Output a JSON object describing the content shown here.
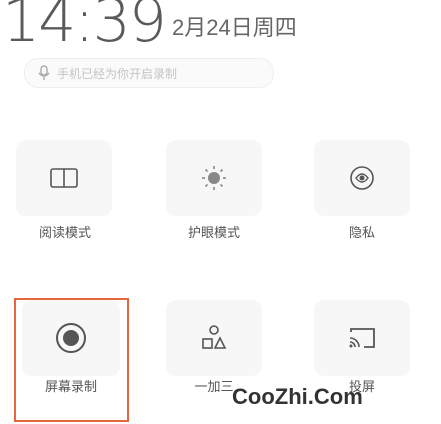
{
  "status_bar": {
    "time": "14:39",
    "date": "2月24日周四"
  },
  "search_hint": {
    "text": "手机已经为你开启录制",
    "icon": "mic-icon"
  },
  "tiles": [
    {
      "label": "阅读模式",
      "icon": "reader-icon"
    },
    {
      "label": "护眼模式",
      "icon": "brightness-icon"
    },
    {
      "label": "隐私",
      "icon": "privacy-icon"
    },
    {
      "label": "屏幕录制",
      "icon": "record-icon",
      "highlighted": true
    },
    {
      "label": "一加三",
      "icon": "shapes-icon"
    },
    {
      "label": "投屏",
      "icon": "cast-icon"
    }
  ],
  "watermark": "CooZhi.Com",
  "accent_color": "#e8663e"
}
